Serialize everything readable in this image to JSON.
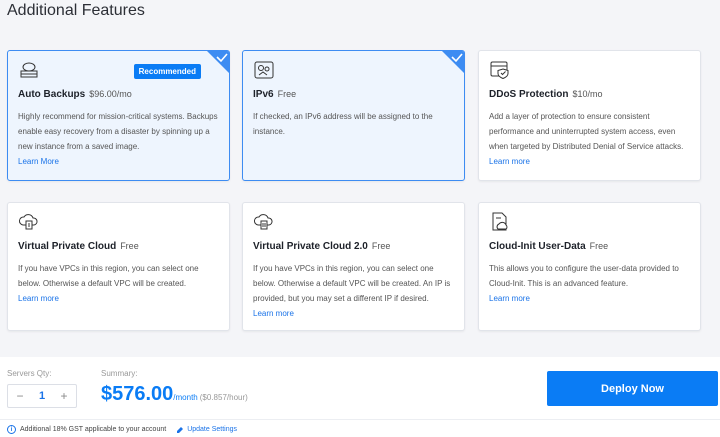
{
  "section_title": "Additional Features",
  "cards": [
    {
      "title": "Auto Backups",
      "price": "$96.00/mo",
      "badge": "Recommended",
      "desc": "Highly recommend for mission-critical systems. Backups enable easy recovery from a disaster by spinning up a new instance from a saved image.",
      "more": "Learn More",
      "icon": "backup-cloud-icon",
      "selected": true
    },
    {
      "title": "IPv6",
      "price": "Free",
      "desc": "If checked, an IPv6 address will be assigned to the instance.",
      "more": "",
      "icon": "ipv6-map-icon",
      "selected": true
    },
    {
      "title": "DDoS Protection",
      "price": "$10/mo",
      "desc": "Add a layer of protection to ensure consistent performance and uninterrupted system access, even when targeted by Distributed Denial of Service attacks.",
      "more": "Learn more",
      "icon": "shield-window-icon",
      "selected": false
    },
    {
      "title": "Virtual Private Cloud",
      "price": "Free",
      "desc": "If you have VPCs in this region, you can select one below. Otherwise a default VPC will be created.",
      "more": "Learn more",
      "icon": "vpc-cloud-icon",
      "selected": false
    },
    {
      "title": "Virtual Private Cloud 2.0",
      "price": "Free",
      "desc": "If you have VPCs in this region, you can select one below. Otherwise a default VPC will be created. An IP is provided, but you may set a different IP if desired.",
      "more": "Learn more",
      "icon": "vpc2-cloud-icon",
      "selected": false
    },
    {
      "title": "Cloud-Init User-Data",
      "price": "Free",
      "desc": "This allows you to configure the user-data provided to Cloud-Init. This is an advanced feature.",
      "more": "Learn more",
      "icon": "cloud-init-doc-icon",
      "selected": false
    }
  ],
  "footer": {
    "qty_label": "Servers Qty:",
    "qty_value": "1",
    "minus": "−",
    "plus": "+",
    "summary_label": "Summary:",
    "summary_price": "$576.00",
    "summary_per": "/month",
    "summary_hour": "($0.857/hour)",
    "deploy_label": "Deploy Now",
    "gst_text": "Additional 18% GST applicable to your account",
    "gst_link": "Update Settings",
    "info_glyph": "i"
  },
  "colors": {
    "accent": "#0a7cf5",
    "selected_bg": "#eef5fe",
    "selected_border": "#3d8cf2"
  }
}
